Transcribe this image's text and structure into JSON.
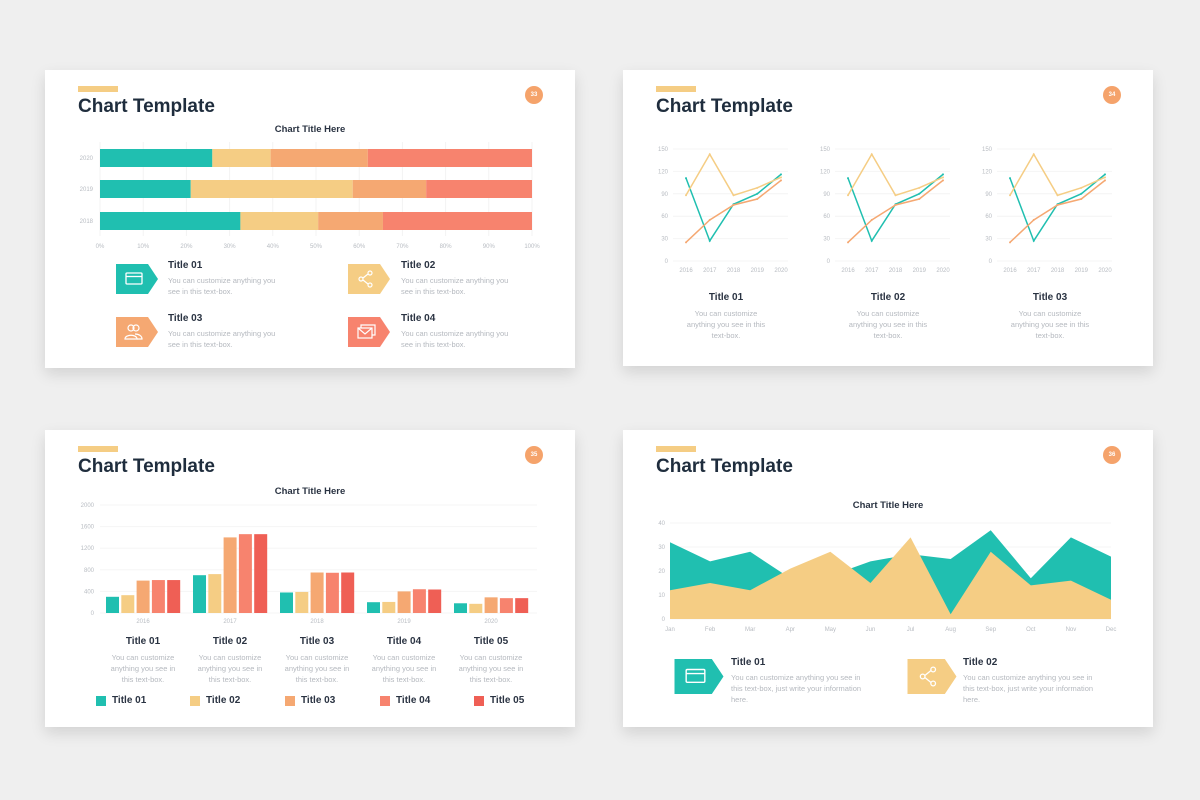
{
  "colors": {
    "teal": "#20bfb0",
    "yellow": "#f5cd84",
    "orange": "#f5a872",
    "salmon": "#f7836e",
    "red": "#ef5f55",
    "badge": "#f5a36b"
  },
  "slides": [
    {
      "title": "Chart Template",
      "number": "33",
      "chart_title": "Chart Title Here",
      "items": [
        {
          "title": "Title 01",
          "text": "You can customize anything you see in this text-box.",
          "icon": "credit-card-icon",
          "color": "#20bfb0"
        },
        {
          "title": "Title 02",
          "text": "You can customize anything you see in this text-box.",
          "icon": "share-icon",
          "color": "#f5cd84"
        },
        {
          "title": "Title 03",
          "text": "You can customize anything you see in this text-box.",
          "icon": "users-icon",
          "color": "#f5a872"
        },
        {
          "title": "Title 04",
          "text": "You can customize anything you see in this text-box.",
          "icon": "mail-icon",
          "color": "#f7836e"
        }
      ]
    },
    {
      "title": "Chart Template",
      "number": "34",
      "items": [
        {
          "title": "Title 01",
          "text": "You can customize anything you see in this text-box."
        },
        {
          "title": "Title 02",
          "text": "You can customize anything you see in this text-box."
        },
        {
          "title": "Title 03",
          "text": "You can customize anything you see in this text-box."
        }
      ]
    },
    {
      "title": "Chart Template",
      "number": "35",
      "chart_title": "Chart Title Here",
      "items": [
        {
          "title": "Title 01",
          "text": "You can customize anything you see in this text-box."
        },
        {
          "title": "Title 02",
          "text": "You can customize anything you see in this text-box."
        },
        {
          "title": "Title 03",
          "text": "You can customize anything you see in this text-box."
        },
        {
          "title": "Title 04",
          "text": "You can customize anything you see in this text-box."
        },
        {
          "title": "Title 05",
          "text": "You can customize anything you see in this text-box."
        }
      ],
      "legend": [
        "Title 01",
        "Title 02",
        "Title 03",
        "Title 04",
        "Title 05"
      ]
    },
    {
      "title": "Chart Template",
      "number": "36",
      "chart_title": "Chart Title Here",
      "items": [
        {
          "title": "Title 01",
          "text": "You can customize anything you see in this text-box, just write your information here.",
          "icon": "credit-card-icon",
          "color": "#20bfb0"
        },
        {
          "title": "Title 02",
          "text": "You can customize anything you see in this text-box, just write your information here.",
          "icon": "share-icon",
          "color": "#f5cd84"
        }
      ]
    }
  ],
  "chart_data": [
    {
      "type": "bar",
      "orientation": "horizontal",
      "stacked": "percent",
      "title": "Chart Title Here",
      "categories": [
        "2020",
        "2019",
        "2018"
      ],
      "series": [
        {
          "values": [
            26,
            21,
            32.5
          ]
        },
        {
          "values": [
            13.5,
            37.5,
            18
          ]
        },
        {
          "values": [
            22.5,
            17,
            15
          ]
        },
        {
          "values": [
            38,
            24.5,
            34.5
          ]
        }
      ],
      "xticks": [
        "0%",
        "10%",
        "20%",
        "30%",
        "40%",
        "50%",
        "60%",
        "70%",
        "80%",
        "90%",
        "100%"
      ],
      "xlim": [
        0,
        100
      ],
      "grid": true
    },
    {
      "type": "line",
      "x": [
        "2016",
        "2017",
        "2018",
        "2019",
        "2020"
      ],
      "ylim": [
        0,
        150
      ],
      "yticks": [
        "0",
        "30",
        "60",
        "90",
        "120",
        "150"
      ],
      "series": [
        {
          "values": [
            111,
            27,
            76,
            90,
            116
          ]
        },
        {
          "values": [
            88,
            143,
            88,
            98,
            112
          ]
        },
        {
          "values": [
            25,
            55,
            75,
            83,
            108
          ]
        }
      ],
      "grid": true,
      "panels": 3
    },
    {
      "type": "bar",
      "title": "Chart Title Here",
      "categories": [
        "2016",
        "2017",
        "2018",
        "2019",
        "2020"
      ],
      "ylim": [
        0,
        2000
      ],
      "yticks": [
        "0",
        "400",
        "800",
        "1200",
        "1600",
        "2000"
      ],
      "series": [
        {
          "name": "Title 01",
          "values": [
            300,
            700,
            380,
            200,
            180
          ]
        },
        {
          "name": "Title 02",
          "values": [
            330,
            720,
            390,
            205,
            170
          ]
        },
        {
          "name": "Title 03",
          "values": [
            600,
            1400,
            750,
            400,
            290
          ]
        },
        {
          "name": "Title 04",
          "values": [
            610,
            1460,
            745,
            440,
            275
          ]
        },
        {
          "name": "Title 05",
          "values": [
            610,
            1460,
            750,
            435,
            275
          ]
        }
      ],
      "grid": true,
      "legend": "bottom"
    },
    {
      "type": "area",
      "title": "Chart Title Here",
      "x": [
        "Jan",
        "Feb",
        "Mar",
        "Apr",
        "May",
        "Jun",
        "Jul",
        "Aug",
        "Sep",
        "Oct",
        "Nov",
        "Dec"
      ],
      "ylim": [
        0,
        40
      ],
      "yticks": [
        "0",
        "10",
        "20",
        "30",
        "40"
      ],
      "series": [
        {
          "values": [
            32,
            24,
            28,
            17,
            18,
            24,
            27,
            25,
            37,
            17,
            34,
            26
          ]
        },
        {
          "values": [
            12,
            15,
            12,
            21,
            28,
            15,
            34,
            2,
            28,
            14,
            16,
            8
          ]
        }
      ],
      "grid": true
    }
  ]
}
